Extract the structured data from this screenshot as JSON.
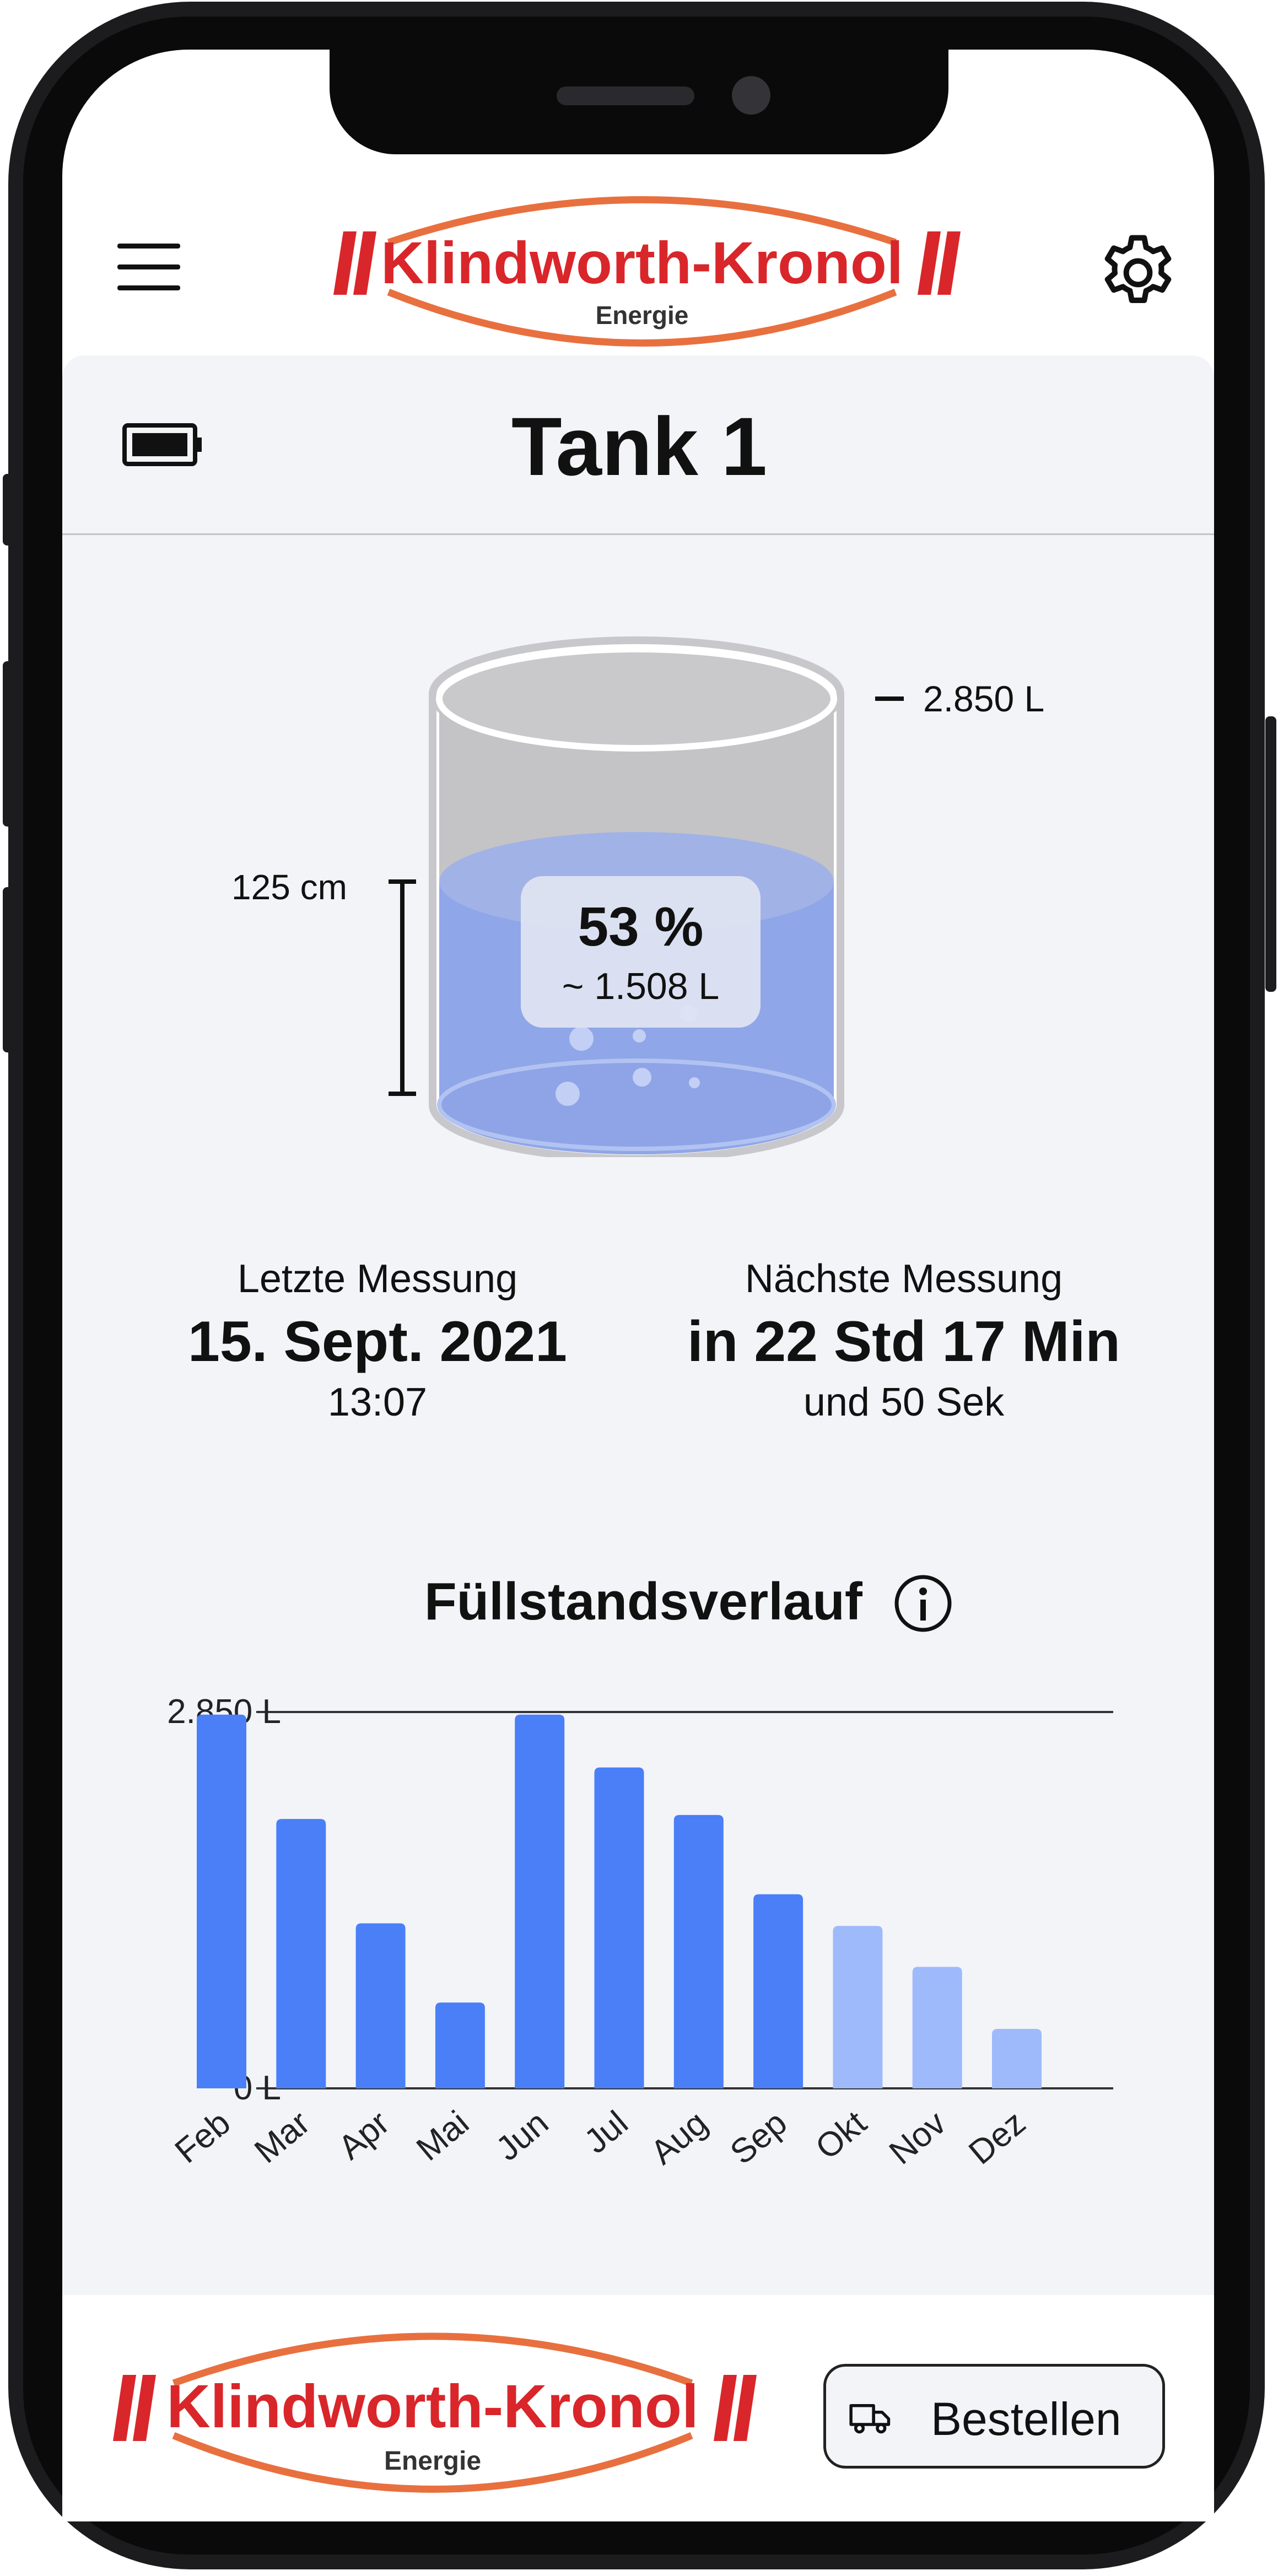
{
  "header": {
    "brand": "Klindworth-Kronol",
    "brand_sub": "Energie"
  },
  "tank": {
    "title": "Tank 1",
    "capacity_label": "2.850 L",
    "height_label": "125 cm",
    "fill_percent_label": "53 %",
    "fill_volume_label": "~ 1.508 L",
    "fill_fraction": 0.53
  },
  "measurements": {
    "last_label": "Letzte Messung",
    "last_date": "15. Sept. 2021",
    "last_time": "13:07",
    "next_label": "Nächste Messung",
    "next_value": "in 22 Std 17 Min",
    "next_extra": "und 50 Sek"
  },
  "chart_section": {
    "title": "Füllstandsverlauf"
  },
  "chart_data": {
    "type": "bar",
    "categories": [
      "Feb",
      "Mar",
      "Apr",
      "Mai",
      "Jun",
      "Jul",
      "Aug",
      "Sep",
      "Okt",
      "Nov",
      "Dez"
    ],
    "values": [
      2830,
      2040,
      1250,
      650,
      2830,
      2430,
      2070,
      1470,
      1230,
      920,
      450
    ],
    "forecast": [
      false,
      false,
      false,
      false,
      false,
      false,
      false,
      false,
      true,
      true,
      true
    ],
    "ylim": [
      0,
      2850
    ],
    "y_tick_labels": [
      "2.850 L",
      "0 L"
    ],
    "colors": {
      "actual": "#4a7ff7",
      "forecast": "#9fbafb"
    }
  },
  "footer": {
    "brand": "Klindworth-Kronol",
    "brand_sub": "Energie",
    "order_button": "Bestellen"
  },
  "colors": {
    "accent_red": "#d9262a",
    "logo_swoosh": "#e8703f",
    "tank_liquid": "#8fa6e8",
    "bar_blue": "#4a7ff7",
    "bar_light": "#9fbafb"
  }
}
